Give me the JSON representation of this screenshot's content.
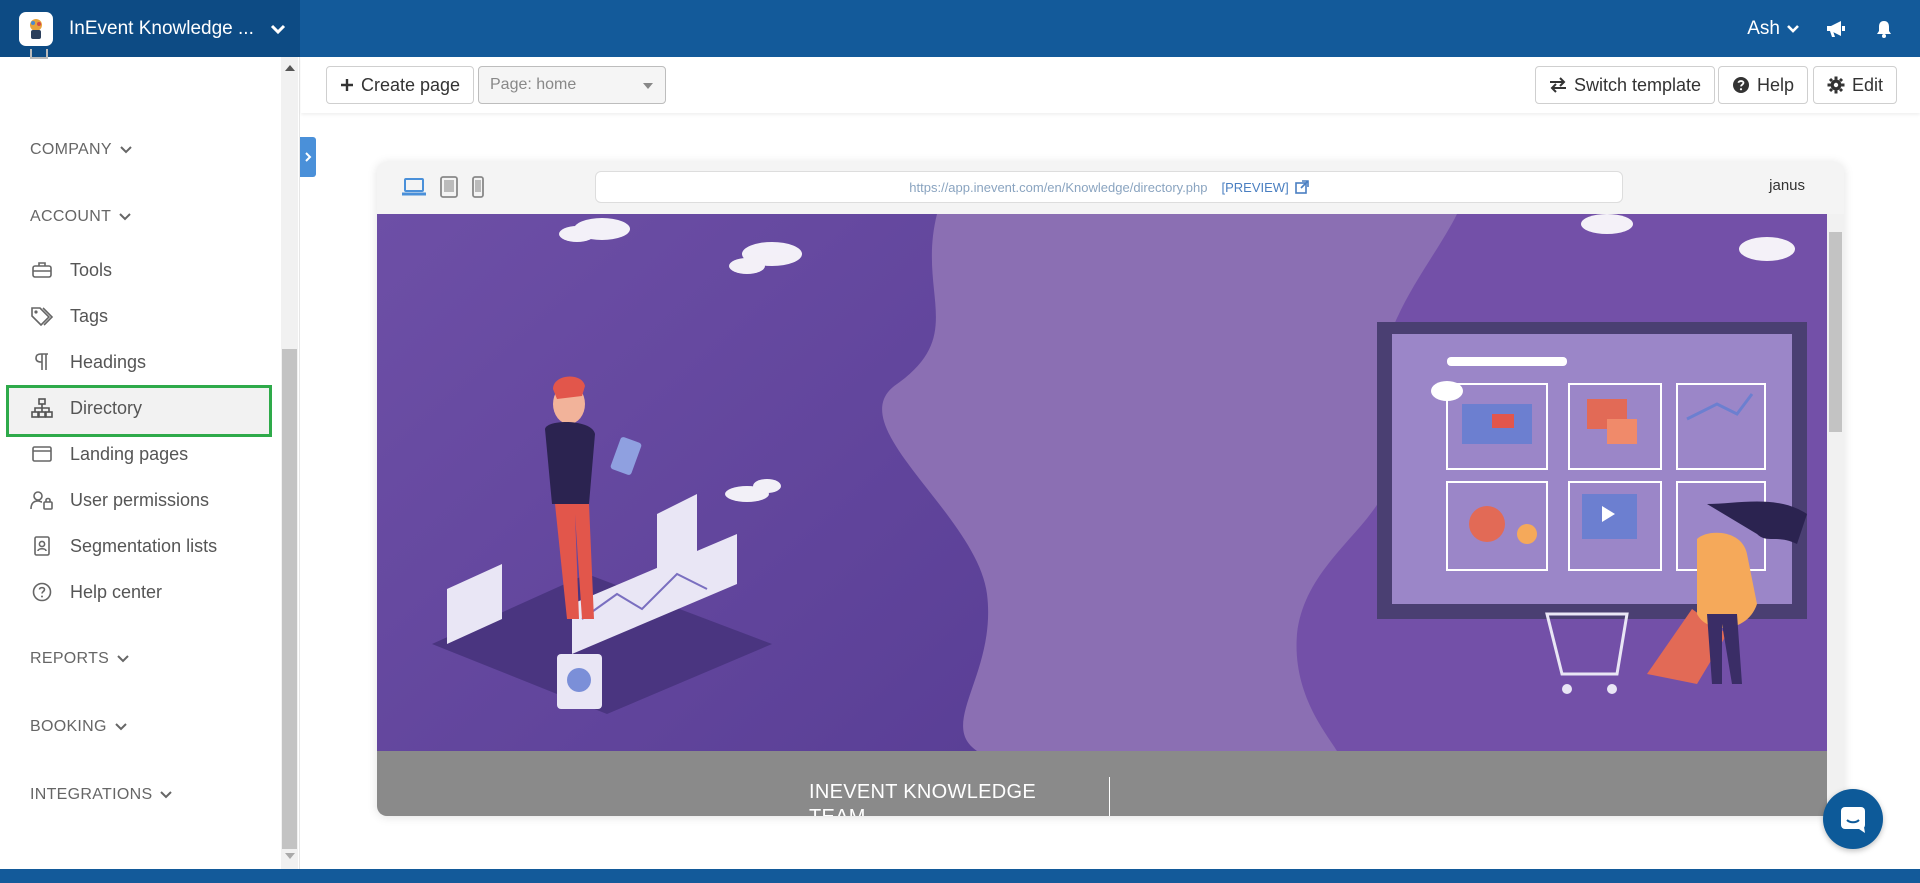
{
  "app": {
    "title": "InEvent Knowledge ...",
    "user": "Ash"
  },
  "sidebar": {
    "sections": {
      "company": "COMPANY",
      "account": "ACCOUNT",
      "reports": "REPORTS",
      "booking": "BOOKING",
      "integrations": "INTEGRATIONS"
    },
    "items": [
      {
        "label": "Tools",
        "icon": "toolbox-icon"
      },
      {
        "label": "Tags",
        "icon": "tags-icon"
      },
      {
        "label": "Headings",
        "icon": "paragraph-icon"
      },
      {
        "label": "Directory",
        "icon": "sitemap-icon",
        "active": true
      },
      {
        "label": "Landing pages",
        "icon": "window-icon"
      },
      {
        "label": "User permissions",
        "icon": "user-lock-icon"
      },
      {
        "label": "Segmentation lists",
        "icon": "contact-card-icon"
      },
      {
        "label": "Help center",
        "icon": "question-circle-icon"
      }
    ],
    "active_color": "#2eaa4a"
  },
  "toolbar": {
    "create_page": "Create page",
    "page_select": "Page: home",
    "switch_template": "Switch template",
    "help": "Help",
    "edit": "Edit"
  },
  "preview": {
    "url": "https://app.inevent.com/en/Knowledge/directory.php",
    "preview_label": "[PREVIEW]",
    "user": "janus",
    "band_title": "INEVENT KNOWLEDGE TEAM"
  },
  "colors": {
    "topbar": "#135a9a",
    "brand_bg": "#0d4b84",
    "hero_purple": "#7c58a6",
    "band_gray": "#8a8a8a",
    "accent_blue": "#4a90d9"
  }
}
